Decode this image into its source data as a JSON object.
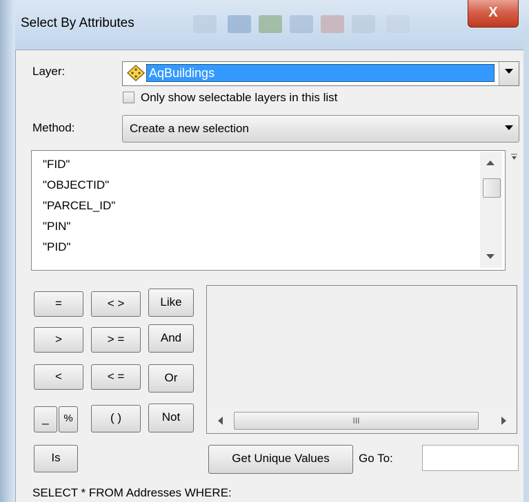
{
  "window": {
    "title": "Select By Attributes",
    "close_glyph": "X"
  },
  "layer": {
    "label": "Layer:",
    "value": "AqBuildings",
    "icon": "layer-diamond-icon",
    "checkbox_label": "Only show selectable layers in this list",
    "checkbox_checked": false
  },
  "method": {
    "label": "Method:",
    "value": "Create a new selection"
  },
  "fields": [
    "\"FID\"",
    "\"OBJECTID\"",
    "\"PARCEL_ID\"",
    "\"PIN\"",
    "\"PID\""
  ],
  "operators": {
    "eq": "=",
    "ne": "< >",
    "like": "Like",
    "gt": ">",
    "ge": "> =",
    "and": "And",
    "lt": "<",
    "le": "< =",
    "or": "Or",
    "underscore": "_",
    "percent": "%",
    "parens": "( )",
    "not": "Not",
    "is": "Is"
  },
  "values_panel": {
    "scroll_grip": "III"
  },
  "get_unique_values": "Get Unique Values",
  "goto": {
    "label": "Go To:",
    "value": ""
  },
  "sql_prefix": "SELECT * FROM Addresses WHERE:",
  "colors": {
    "selection": "#3399ff",
    "close_button": "#c84a33",
    "panel": "#f0f0f0"
  }
}
